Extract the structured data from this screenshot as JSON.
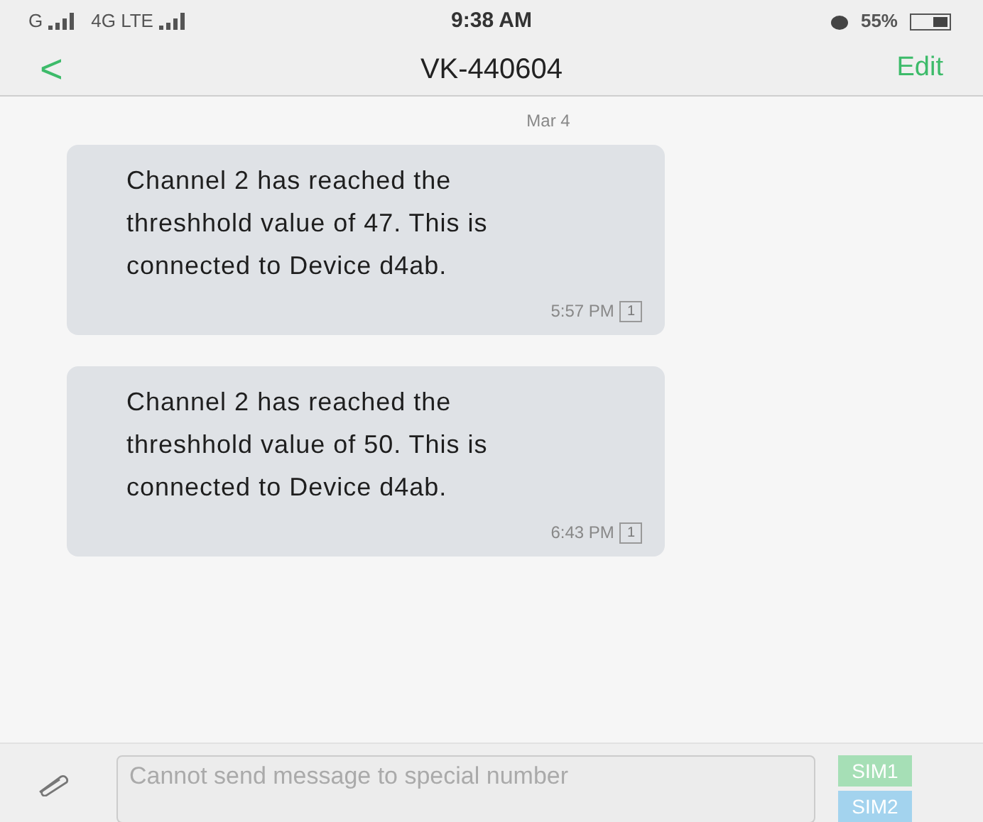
{
  "status_bar": {
    "carrier_1": "G",
    "carrier_2": "4G LTE",
    "time": "9:38 AM",
    "battery": "55%"
  },
  "header": {
    "back": "<",
    "title": "VK-440604",
    "action": "Edit"
  },
  "date": "Mar 4",
  "messages": [
    {
      "text": "Channel 2 has reached the threshhold value of 47. This is connected to Device d4ab.",
      "time": "5:57 PM",
      "sim": "1"
    },
    {
      "text": "Channel 2 has reached the threshhold value of 50. This is connected to Device d4ab.",
      "time": "6:43 PM",
      "sim": "1"
    }
  ],
  "composer": {
    "placeholder": "Cannot send message to special number",
    "sims": [
      {
        "label": "SIM1",
        "color": "#a6dfb6"
      },
      {
        "label": "SIM2",
        "color": "#a3d3ee"
      }
    ]
  }
}
